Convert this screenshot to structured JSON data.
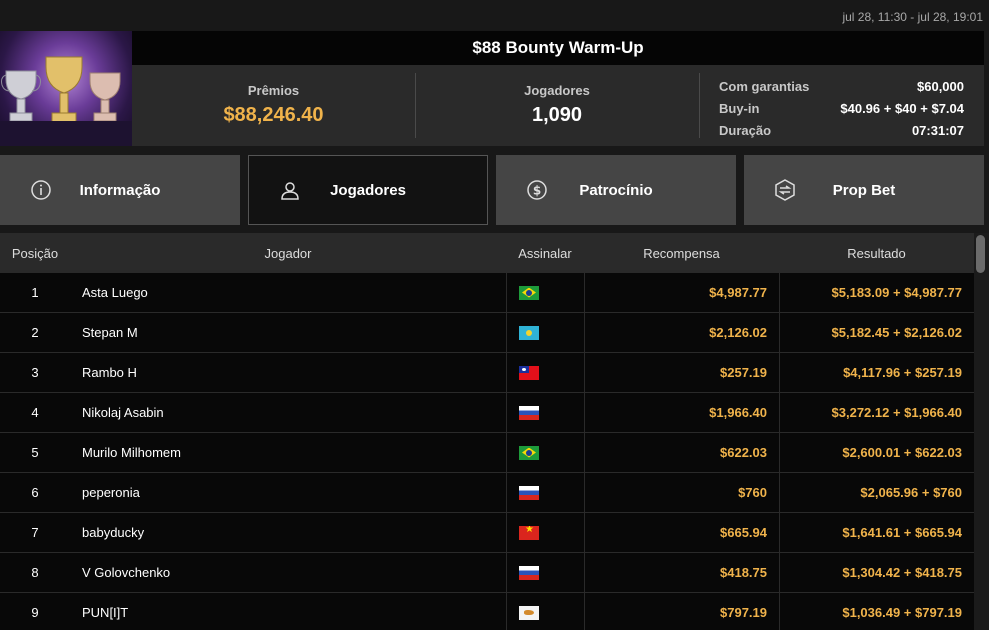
{
  "date_range": "jul 28, 11:30 - jul 28, 19:01",
  "tournament": {
    "title": "$88 Bounty Warm-Up",
    "prize_label": "Prêmios",
    "prize_value": "$88,246.40",
    "players_label": "Jogadores",
    "players_value": "1,090",
    "details": [
      {
        "key": "Com garantias",
        "value": "$60,000"
      },
      {
        "key": "Buy-in",
        "value": "$40.96 + $40 + $7.04"
      },
      {
        "key": "Duração",
        "value": "07:31:07"
      }
    ]
  },
  "tabs": [
    {
      "label": "Informação",
      "icon": "info-icon",
      "active": false
    },
    {
      "label": "Jogadores",
      "icon": "user-icon",
      "active": true
    },
    {
      "label": "Patrocínio",
      "icon": "dollar-coin-icon",
      "active": false
    },
    {
      "label": "Prop Bet",
      "icon": "prop-bet-icon",
      "active": false
    }
  ],
  "table": {
    "headers": {
      "position": "Posição",
      "player": "Jogador",
      "flag": "Assinalar",
      "reward": "Recompensa",
      "result": "Resultado"
    },
    "rows": [
      {
        "pos": "1",
        "player": "Asta Luego",
        "flag": "br",
        "reward": "$4,987.77",
        "result": "$5,183.09 + $4,987.77"
      },
      {
        "pos": "2",
        "player": "Stepan M",
        "flag": "kz",
        "reward": "$2,126.02",
        "result": "$5,182.45 + $2,126.02"
      },
      {
        "pos": "3",
        "player": "Rambo H",
        "flag": "tw",
        "reward": "$257.19",
        "result": "$4,117.96 + $257.19"
      },
      {
        "pos": "4",
        "player": "Nikolaj Asabin",
        "flag": "ru",
        "reward": "$1,966.40",
        "result": "$3,272.12 + $1,966.40"
      },
      {
        "pos": "5",
        "player": "Murilo Milhomem",
        "flag": "br",
        "reward": "$622.03",
        "result": "$2,600.01 + $622.03"
      },
      {
        "pos": "6",
        "player": "peperonia",
        "flag": "ru",
        "reward": "$760",
        "result": "$2,065.96 + $760"
      },
      {
        "pos": "7",
        "player": "babyducky",
        "flag": "vn",
        "reward": "$665.94",
        "result": "$1,641.61 + $665.94"
      },
      {
        "pos": "8",
        "player": "V Golovchenko",
        "flag": "ru",
        "reward": "$418.75",
        "result": "$1,304.42 + $418.75"
      },
      {
        "pos": "9",
        "player": "PUN[I]T",
        "flag": "cy",
        "reward": "$797.19",
        "result": "$1,036.49 + $797.19"
      }
    ]
  },
  "colors": {
    "accent_gold": "#f0b34b",
    "background": "#181818",
    "panel": "#2a2a2a",
    "tab": "#454545"
  }
}
